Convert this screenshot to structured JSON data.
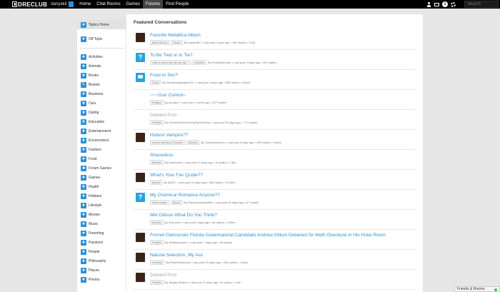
{
  "topbar": {
    "logo_text": "DRECLUB",
    "username": "danyakil",
    "nav": [
      "Home",
      "Chat Rooms",
      "Games",
      "Forums",
      "Find People"
    ],
    "active_nav": "Forums",
    "notification_count": "1",
    "search_placeholder": "Search"
  },
  "sidebar": {
    "items": [
      {
        "label": "Topics Home",
        "icon": "star-icon",
        "active": true
      },
      {
        "label": "Off Topic",
        "icon": "star-icon"
      },
      {
        "label": "Activities",
        "icon": "star-icon"
      },
      {
        "label": "Animals",
        "icon": "star-icon"
      },
      {
        "label": "Books",
        "icon": "star-icon"
      },
      {
        "label": "Brands",
        "icon": "pen-icon"
      },
      {
        "label": "Business",
        "icon": "star-icon"
      },
      {
        "label": "Cars",
        "icon": "star-icon"
      },
      {
        "label": "Dating",
        "icon": "heart-icon"
      },
      {
        "label": "Education",
        "icon": "star-icon"
      },
      {
        "label": "Entertainment",
        "icon": "star-icon"
      },
      {
        "label": "Environment",
        "icon": "star-icon"
      },
      {
        "label": "Fashion",
        "icon": "star-icon"
      },
      {
        "label": "Food",
        "icon": "star-icon"
      },
      {
        "label": "Forum Games",
        "icon": "square-icon"
      },
      {
        "label": "Games",
        "icon": "star-icon"
      },
      {
        "label": "Health",
        "icon": "star-icon"
      },
      {
        "label": "Hobbies",
        "icon": "star-icon"
      },
      {
        "label": "Lifestyle",
        "icon": "star-icon"
      },
      {
        "label": "Movies",
        "icon": "star-icon"
      },
      {
        "label": "Music",
        "icon": "star-icon"
      },
      {
        "label": "Parenting",
        "icon": "star-icon"
      },
      {
        "label": "Passions",
        "icon": "star-icon"
      },
      {
        "label": "People",
        "icon": "star-icon"
      },
      {
        "label": "Philosophy",
        "icon": "star-icon"
      },
      {
        "label": "Places",
        "icon": "star-icon"
      },
      {
        "label": "Poems",
        "icon": "star-icon"
      }
    ]
  },
  "main": {
    "section_title": "Featured Conversations",
    "conversations": [
      {
        "title": "Favorite Metallica Album",
        "thumb": "img",
        "tags": [
          "Metal Music",
          "Music"
        ],
        "meta": "By usearth87 • Last post 1 year ago • 165 replies • 1 like"
      },
      {
        "title": "To Be Tied or to Tie?",
        "thumb": "q",
        "tags": [
          "I like it when you tie me up...",
          "Hobbies"
        ],
        "meta": "By FireBallsGoner • Last post 2 days ago • 102 replies"
      },
      {
        "title": "Food or Sex?",
        "thumb": "chat",
        "tags": [
          "Food"
        ],
        "meta": "By karmavaniigbaby2011 • Last post 3 days ago • 385 replies • 8 likes"
      },
      {
        "title": "~~~Gun Control~",
        "thumb": "",
        "tags": [
          "Politics"
        ],
        "meta": "By joe.gin2 • Last post 1 month ago • 227 replies"
      },
      {
        "title": "Deleted Post",
        "thumb": "",
        "deleted": true,
        "tags": [
          "Politics"
        ],
        "meta": "By DaGeDaGeDaGeDaGeGeDaGe • Last post 20 days ago • 771 replies"
      },
      {
        "title": "Hottest Vampire??",
        "thumb": "img",
        "tags": [
          "Horror Movies & Scared",
          "Movies"
        ],
        "meta": "By Goldievampires • Last post 6 days ago • 295 replies • 5 likes"
      },
      {
        "title": "Shameless",
        "thumb": "",
        "tags": [
          "Movies"
        ],
        "meta": "By lastmovies • Last post 10 days ago • 8 replies • 1 like"
      },
      {
        "title": "What's Your Fav Quote??",
        "thumb": "img",
        "tags": [
          "Books"
        ],
        "meta": "By MOE? • Last post 14 days ago • 283 replies • 41 likes"
      },
      {
        "title": "My Chemical Romance Anyone??",
        "thumb": "q",
        "tags": [
          "Rock music",
          "Music"
        ],
        "meta": "By RomanticismistGiftz • Last post 18 days ago • 57 replies"
      },
      {
        "title": "Mel Gibson What Do You Think?",
        "thumb": "",
        "tags": [
          "Movies"
        ],
        "meta": "By bird_lane • Last post 2 days ago • 88 replies • 3 likes"
      },
      {
        "title": "Former Democrats Florida Gubernatorial Candidate Andrew Gillum Detained for Meth Overdose in His Hotel Room",
        "thumb": "img",
        "tags": [
          "Politics"
        ],
        "meta": "By tellafrasmokin? • Last post 7 days ago • 95 replies"
      },
      {
        "title": "Natural Selection, My Ass",
        "thumb": "img",
        "tags": [
          "Science"
        ],
        "meta": "By RebelKickendra • Last post 29 days ago • 296 replies • 4 likes"
      },
      {
        "title": "Deleted Post",
        "thumb": "img",
        "deleted": true,
        "tags": [
          "Politics"
        ],
        "meta": "By Sugary Beaver • Last post 11 days ago • 8 replies • 1 like"
      }
    ]
  },
  "footer": {
    "friends_label": "Friends & Rooms"
  }
}
